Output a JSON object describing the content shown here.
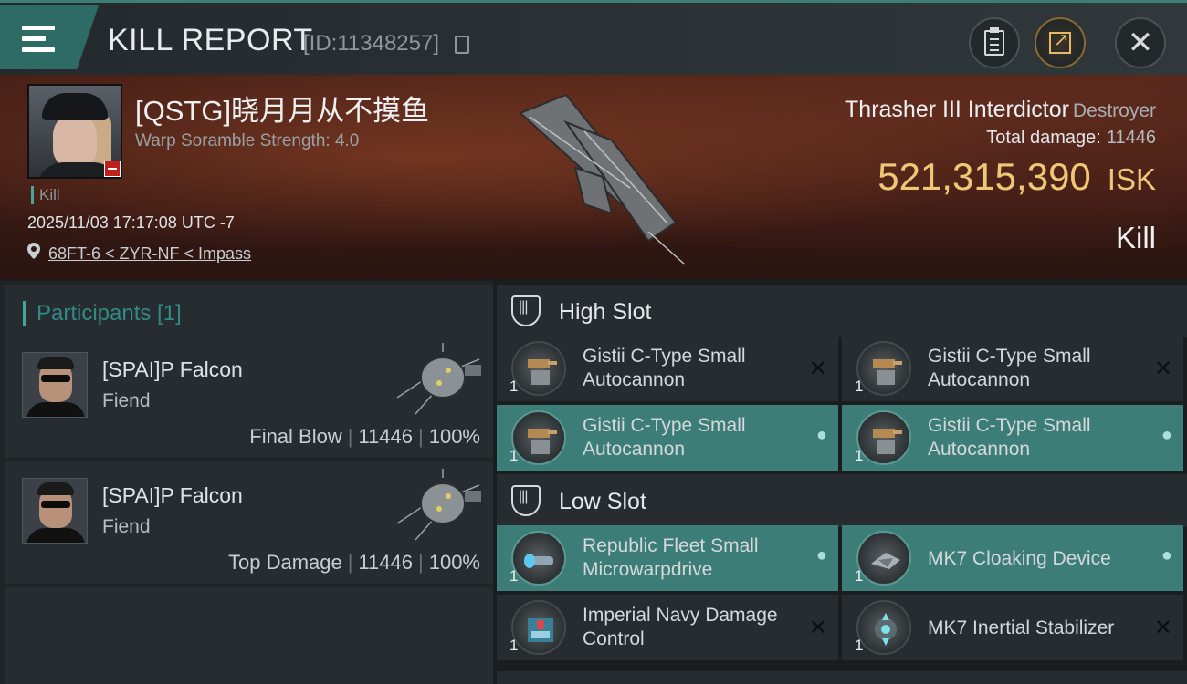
{
  "header": {
    "title": "KILL REPORT",
    "report_id": "[ID:11348257]",
    "icons": [
      "menu-icon",
      "copy-icon",
      "clipboard-icon",
      "share-icon",
      "close-icon"
    ]
  },
  "victim": {
    "name": "[QSTG]晓月月从不摸鱼",
    "warp_scramble": "Warp Soramble Strength: 4.0",
    "tag": "Kill",
    "datetime": "2025/11/03 17:17:08 UTC -7",
    "location": "68FT-6 < ZYR-NF < Impass"
  },
  "ship": {
    "name": "Thrasher III Interdictor",
    "class": "Destroyer",
    "total_damage_label": "Total damage:",
    "total_damage": "11446",
    "value": "521,315,390",
    "currency": "ISK",
    "outcome": "Kill"
  },
  "participants": {
    "header": "Participants [1]",
    "rows": [
      {
        "name": "[SPAI]P Falcon",
        "ship": "Fiend",
        "role": "Final Blow",
        "damage": "11446",
        "percent": "100%"
      },
      {
        "name": "[SPAI]P Falcon",
        "ship": "Fiend",
        "role": "Top Damage",
        "damage": "11446",
        "percent": "100%"
      }
    ]
  },
  "fitting": {
    "high_slot": {
      "title": "High Slot",
      "modules": [
        {
          "name": "Gistii C-Type Small Autocannon",
          "qty": "1",
          "state": "destroyed"
        },
        {
          "name": "Gistii C-Type Small Autocannon",
          "qty": "1",
          "state": "destroyed"
        },
        {
          "name": "Gistii C-Type Small Autocannon",
          "qty": "1",
          "state": "dropped"
        },
        {
          "name": "Gistii C-Type Small Autocannon",
          "qty": "1",
          "state": "dropped"
        }
      ]
    },
    "low_slot": {
      "title": "Low Slot",
      "modules": [
        {
          "name": "Republic Fleet Small Microwarpdrive",
          "qty": "1",
          "state": "dropped"
        },
        {
          "name": "MK7 Cloaking Device",
          "qty": "1",
          "state": "dropped"
        },
        {
          "name": "Imperial Navy Damage Control",
          "qty": "1",
          "state": "destroyed"
        },
        {
          "name": "MK7 Inertial Stabilizer",
          "qty": "1",
          "state": "destroyed"
        }
      ]
    }
  },
  "colors": {
    "accent_teal": "#3d7d77",
    "isk_gold": "#f1c777",
    "badge_red": "#c0201c"
  }
}
